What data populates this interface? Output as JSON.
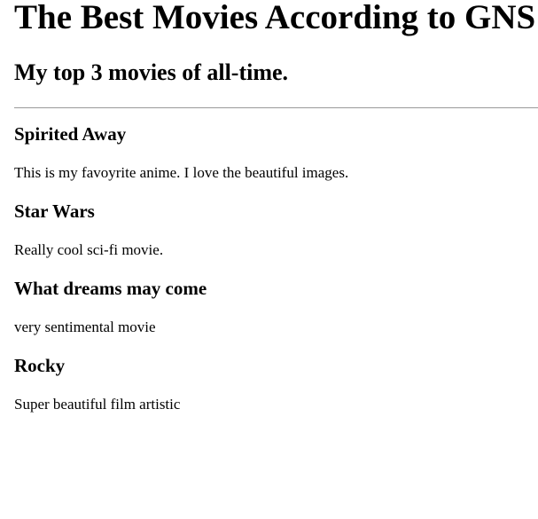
{
  "page": {
    "title": "The Best Movies According to GNS",
    "subtitle": "My top 3 movies of all-time."
  },
  "movies": [
    {
      "name": "Spirited Away",
      "description": "This is my favoyrite anime. I love the beautiful images."
    },
    {
      "name": "Star Wars",
      "description": "Really cool sci-fi movie."
    },
    {
      "name": "What dreams may come",
      "description": "very sentimental movie"
    },
    {
      "name": "Rocky",
      "description": "Super beautiful film artistic"
    }
  ]
}
